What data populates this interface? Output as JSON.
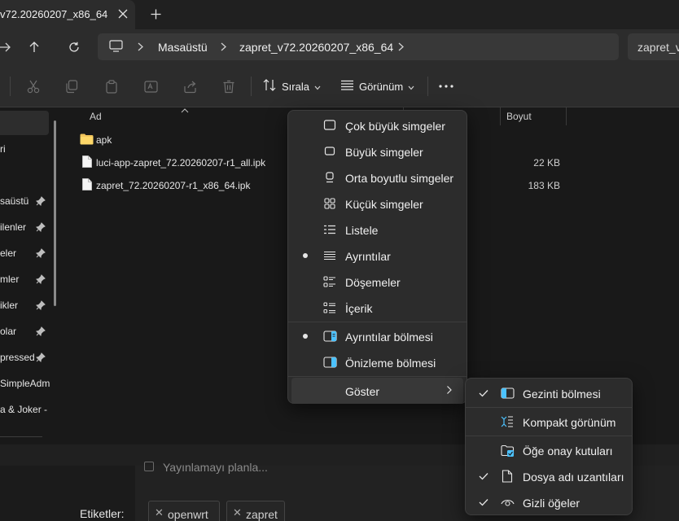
{
  "tab": {
    "title": "v72.20260207_x86_64"
  },
  "address": {
    "crumbs": [
      "Masaüstü",
      "zapret_v72.20260207_x86_64"
    ],
    "search_text": "zapret_v"
  },
  "toolbar": {
    "sort_label": "Sırala",
    "view_label": "Görünüm"
  },
  "sidebar": {
    "items": [
      {
        "label": "ri",
        "pinned": false
      },
      {
        "label": "saüstü",
        "pinned": true
      },
      {
        "label": "ilenler",
        "pinned": true
      },
      {
        "label": "eler",
        "pinned": true
      },
      {
        "label": "mler",
        "pinned": true
      },
      {
        "label": "ikler",
        "pinned": true
      },
      {
        "label": "olar",
        "pinned": true
      },
      {
        "label": "pressed",
        "pinned": true
      },
      {
        "label": "SimpleAdm",
        "pinned": false
      },
      {
        "label": "a & Joker -",
        "pinned": false
      }
    ]
  },
  "filelist": {
    "headers": {
      "name": "Ad",
      "size": "Boyut"
    },
    "rows": [
      {
        "name": "apk",
        "type": "folder",
        "size": ""
      },
      {
        "name": "luci-app-zapret_72.20260207-r1_all.ipk",
        "type": "file",
        "size": "22 KB"
      },
      {
        "name": "zapret_72.20260207-r1_x86_64.ipk",
        "type": "file",
        "size": "183 KB"
      }
    ]
  },
  "view_menu": {
    "items": [
      {
        "label": "Çok büyük simgeler",
        "icon": "monitor-xl-icon",
        "selected": false
      },
      {
        "label": "Büyük simgeler",
        "icon": "monitor-lg-icon",
        "selected": false
      },
      {
        "label": "Orta boyutlu simgeler",
        "icon": "monitor-md-icon",
        "selected": false
      },
      {
        "label": "Küçük simgeler",
        "icon": "grid-small-icon",
        "selected": false
      },
      {
        "label": "Listele",
        "icon": "list-icon",
        "selected": false
      },
      {
        "label": "Ayrıntılar",
        "icon": "details-icon",
        "selected": true
      },
      {
        "label": "Döşemeler",
        "icon": "tiles-icon",
        "selected": false
      },
      {
        "label": "İçerik",
        "icon": "content-icon",
        "selected": false
      },
      {
        "label": "Ayrıntılar bölmesi",
        "icon": "details-pane-icon",
        "selected": true
      },
      {
        "label": "Önizleme bölmesi",
        "icon": "preview-pane-icon",
        "selected": false
      },
      {
        "label": "Göster",
        "icon": "",
        "selected": false,
        "submenu": true
      }
    ]
  },
  "show_submenu": {
    "items": [
      {
        "label": "Gezinti bölmesi",
        "icon": "navigation-pane-icon",
        "checked": true
      },
      {
        "label": "Kompakt görünüm",
        "icon": "compact-view-icon",
        "checked": false
      },
      {
        "label": "Öğe onay kutuları",
        "icon": "item-checkbox-icon",
        "checked": false
      },
      {
        "label": "Dosya adı uzantıları",
        "icon": "file-extension-icon",
        "checked": true
      },
      {
        "label": "Gizli öğeler",
        "icon": "hidden-items-icon",
        "checked": true
      }
    ]
  },
  "background_page": {
    "publish_text": "Yayınlamayı planla...",
    "tags_label": "Etiketler:",
    "tags": [
      "openwrt",
      "zapret"
    ]
  },
  "colors": {
    "accent": "#4cc2ff",
    "menu_bg": "#2c2c2c",
    "window_bg": "#191919"
  }
}
